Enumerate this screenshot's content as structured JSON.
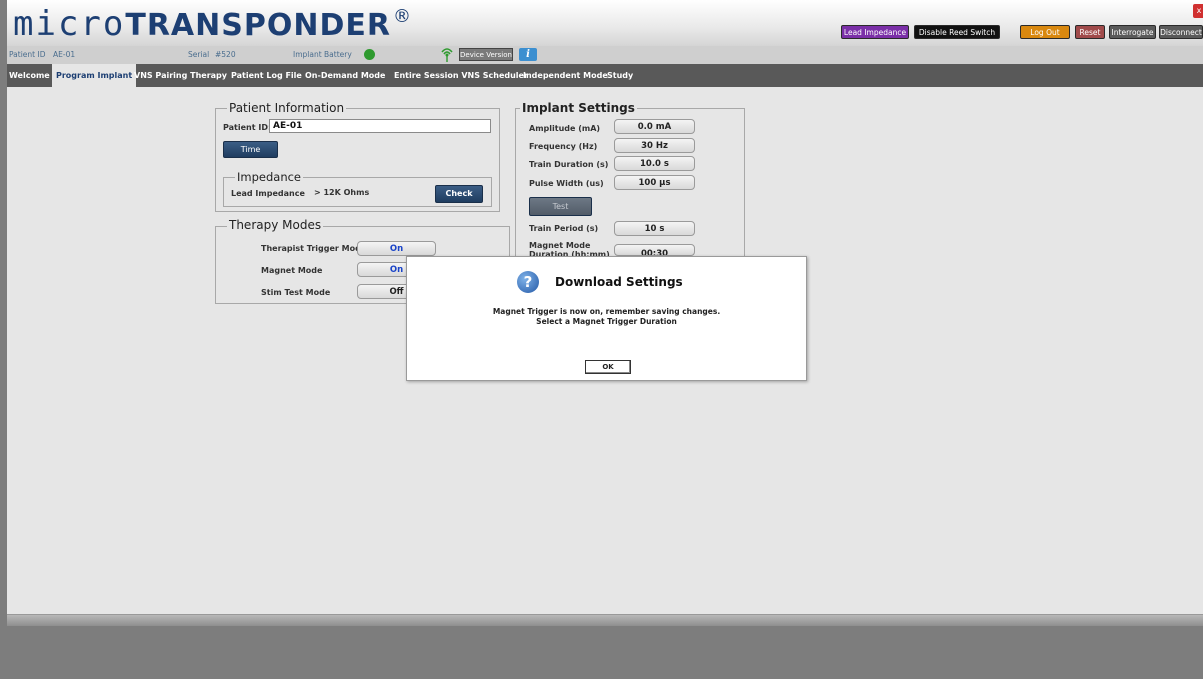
{
  "header": {
    "logo_micro": "micro",
    "logo_trans": "TRANSPONDER",
    "logo_reg": "®",
    "buttons": {
      "lead_impedance": "Lead Impedance",
      "disable_reed": "Disable Reed Switch",
      "log_out": "Log Out",
      "reset": "Reset",
      "interrogate": "Interrogate",
      "disconnect": "Disconnect",
      "close": "x"
    },
    "colors": {
      "lead_impedance": "#7b2fa8",
      "disable_reed": "#111111",
      "log_out": "#d9880f",
      "reset": "#a04a4a",
      "interrogate": "#5a5a5a",
      "disconnect": "#5a5a5a"
    }
  },
  "infobar": {
    "patient_id_label": "Patient ID",
    "patient_id_value": "AE-01",
    "serial_label": "Serial",
    "serial_value": "#520",
    "battery_label": "Implant Battery",
    "battery_icon": "green-circle",
    "antenna_icon": "antenna-icon",
    "device_version": "Device Version",
    "info_icon": "i"
  },
  "nav": {
    "tabs": [
      {
        "label": "Welcome"
      },
      {
        "label": "Program Implant"
      },
      {
        "label": "VNS Pairing Therapy"
      },
      {
        "label": "Patient Log File"
      },
      {
        "label": "On-Demand Mode"
      },
      {
        "label": "Entire Session VNS Scheduler"
      },
      {
        "label": "Independent Mode"
      },
      {
        "label": "Study"
      }
    ],
    "active": "Program Implant"
  },
  "patient_info": {
    "legend": "Patient Information",
    "patient_id_label": "Patient ID:",
    "patient_id_value": "AE-01",
    "time_button": "Time",
    "impedance": {
      "legend": "Impedance",
      "label": "Lead Impedance",
      "value": "> 12K Ohms",
      "check_button": "Check"
    }
  },
  "therapy_modes": {
    "legend": "Therapy Modes",
    "rows": [
      {
        "label": "Therapist Trigger Mode",
        "value": "On"
      },
      {
        "label": "Magnet Mode",
        "value": "On"
      },
      {
        "label": "Stim Test Mode",
        "value": "Off"
      }
    ]
  },
  "implant_settings": {
    "legend": "Implant Settings",
    "rows": [
      {
        "label": "Amplitude (mA)",
        "value": "0.0 mA"
      },
      {
        "label": "Frequency (Hz)",
        "value": "30 Hz"
      },
      {
        "label": "Train Duration (s)",
        "value": "10.0 s"
      },
      {
        "label": "Pulse Width (us)",
        "value": "100 µs"
      }
    ],
    "test_button": "Test",
    "train_period_label": "Train Period (s)",
    "train_period_value": "10 s",
    "magnet_mode_label": "Magnet Mode",
    "magnet_mode_label2": "Duration (hh:mm)",
    "magnet_mode_value": "00:30"
  },
  "dialog": {
    "title": "Download Settings",
    "line1": "Magnet Trigger is now on, remember saving changes.",
    "line2": "Select a Magnet Trigger Duration",
    "ok": "OK",
    "icon": "question-icon"
  }
}
